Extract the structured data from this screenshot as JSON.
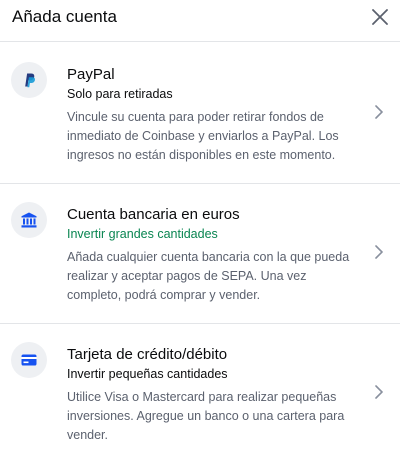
{
  "header": {
    "title": "Añada cuenta"
  },
  "options": [
    {
      "title": "PayPal",
      "subtitle": "Solo para retiradas",
      "description": "Vincule su cuenta para poder retirar fondos de inmediato de Coinbase y enviarlos a PayPal. Los ingresos no están disponibles en este momento.",
      "icon": "paypal-icon"
    },
    {
      "title": "Cuenta bancaria en euros",
      "subtitle": "Invertir grandes cantidades",
      "description": "Añada cualquier cuenta bancaria con la que pueda realizar y aceptar pagos de SEPA. Una vez completo, podrá comprar y vender.",
      "icon": "bank-icon"
    },
    {
      "title": "Tarjeta de crédito/débito",
      "subtitle": "Invertir pequeñas cantidades",
      "description": "Utilice Visa o Mastercard para realizar pequeñas inversiones. Agregue un banco o una cartera para vender.",
      "icon": "credit-card-icon"
    }
  ],
  "colors": {
    "accent_green": "#098551",
    "brand_blue": "#1652f0",
    "icon_bg": "#eef0f3",
    "muted_text": "#5b616e",
    "divider": "#e3e5e8"
  }
}
